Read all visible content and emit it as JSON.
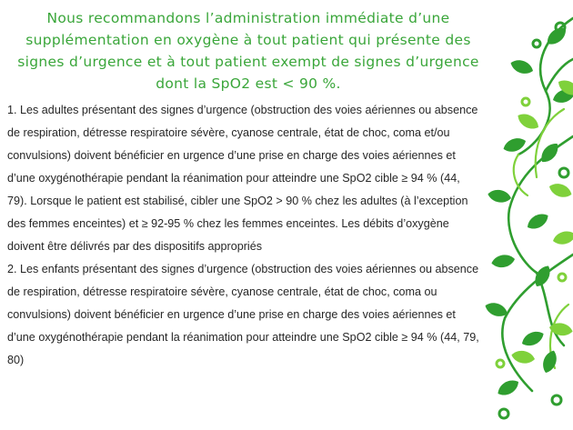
{
  "headline": "Nous recommandons l’administration immédiate d’une supplémentation en oxygène à tout patient qui présente des signes d’urgence et à tout patient exempt de signes d’urgence dont la SpO2 est < 90 %.",
  "paragraphs": [
    "1. Les adultes présentant des signes d’urgence (obstruction des voies aériennes ou absence de respiration, détresse respiratoire sévère, cyanose centrale, état de choc, coma et/ou convulsions) doivent bénéficier en urgence d’une prise en charge des voies aériennes et d’une oxygénothérapie pendant la réanimation pour atteindre une SpO2 cible ≥ 94 % (44, 79). Lorsque le patient est stabilisé, cibler une SpO2 > 90 % chez les adultes (à l’exception des femmes enceintes) et ≥ 92-95 % chez les femmes enceintes. Les débits d’oxygène doivent être délivrés par des dispositifs appropriés",
    "2. Les enfants présentant des signes d’urgence (obstruction des voies aériennes ou absence de respiration, détresse respiratoire sévère, cyanose centrale, état de choc, coma ou convulsions) doivent bénéficier en urgence d’une prise en charge des voies aériennes et d’une oxygénothérapie pendant la réanimation pour atteindre une SpO2 cible ≥ 94 % (44, 79, 80)"
  ],
  "colors": {
    "headline": "#3aa63a",
    "body": "#262626",
    "leaf_dark": "#2f9e2f",
    "leaf_light": "#7fd13b"
  },
  "decoration": {
    "icon": "vine-leaves-icon"
  }
}
